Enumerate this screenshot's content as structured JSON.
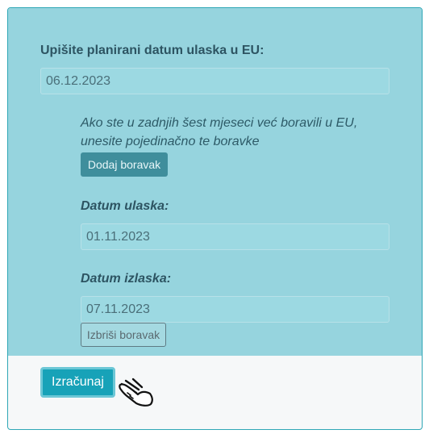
{
  "form": {
    "planned_date_label": "Upišite planirani datum ulaska u EU:",
    "planned_date_value": "06.12.2023",
    "info_text": "Ako ste u zadnjih šest mjeseci već boravili u EU, unesite pojedinačno te boravke",
    "add_stay_label": "Dodaj boravak",
    "stay": {
      "entry_label": "Datum ulaska:",
      "entry_value": "01.11.2023",
      "exit_label": "Datum izlaska:",
      "exit_value": "07.11.2023",
      "delete_label": "Izbriši boravak"
    },
    "calculate_label": "Izračunaj"
  },
  "icons": {
    "cursor": "hand-pointer-icon"
  },
  "colors": {
    "panel_bg": "#96d4de",
    "accent": "#17a2b8",
    "add_button": "#3f8e9c",
    "label_text": "#2d5462"
  }
}
